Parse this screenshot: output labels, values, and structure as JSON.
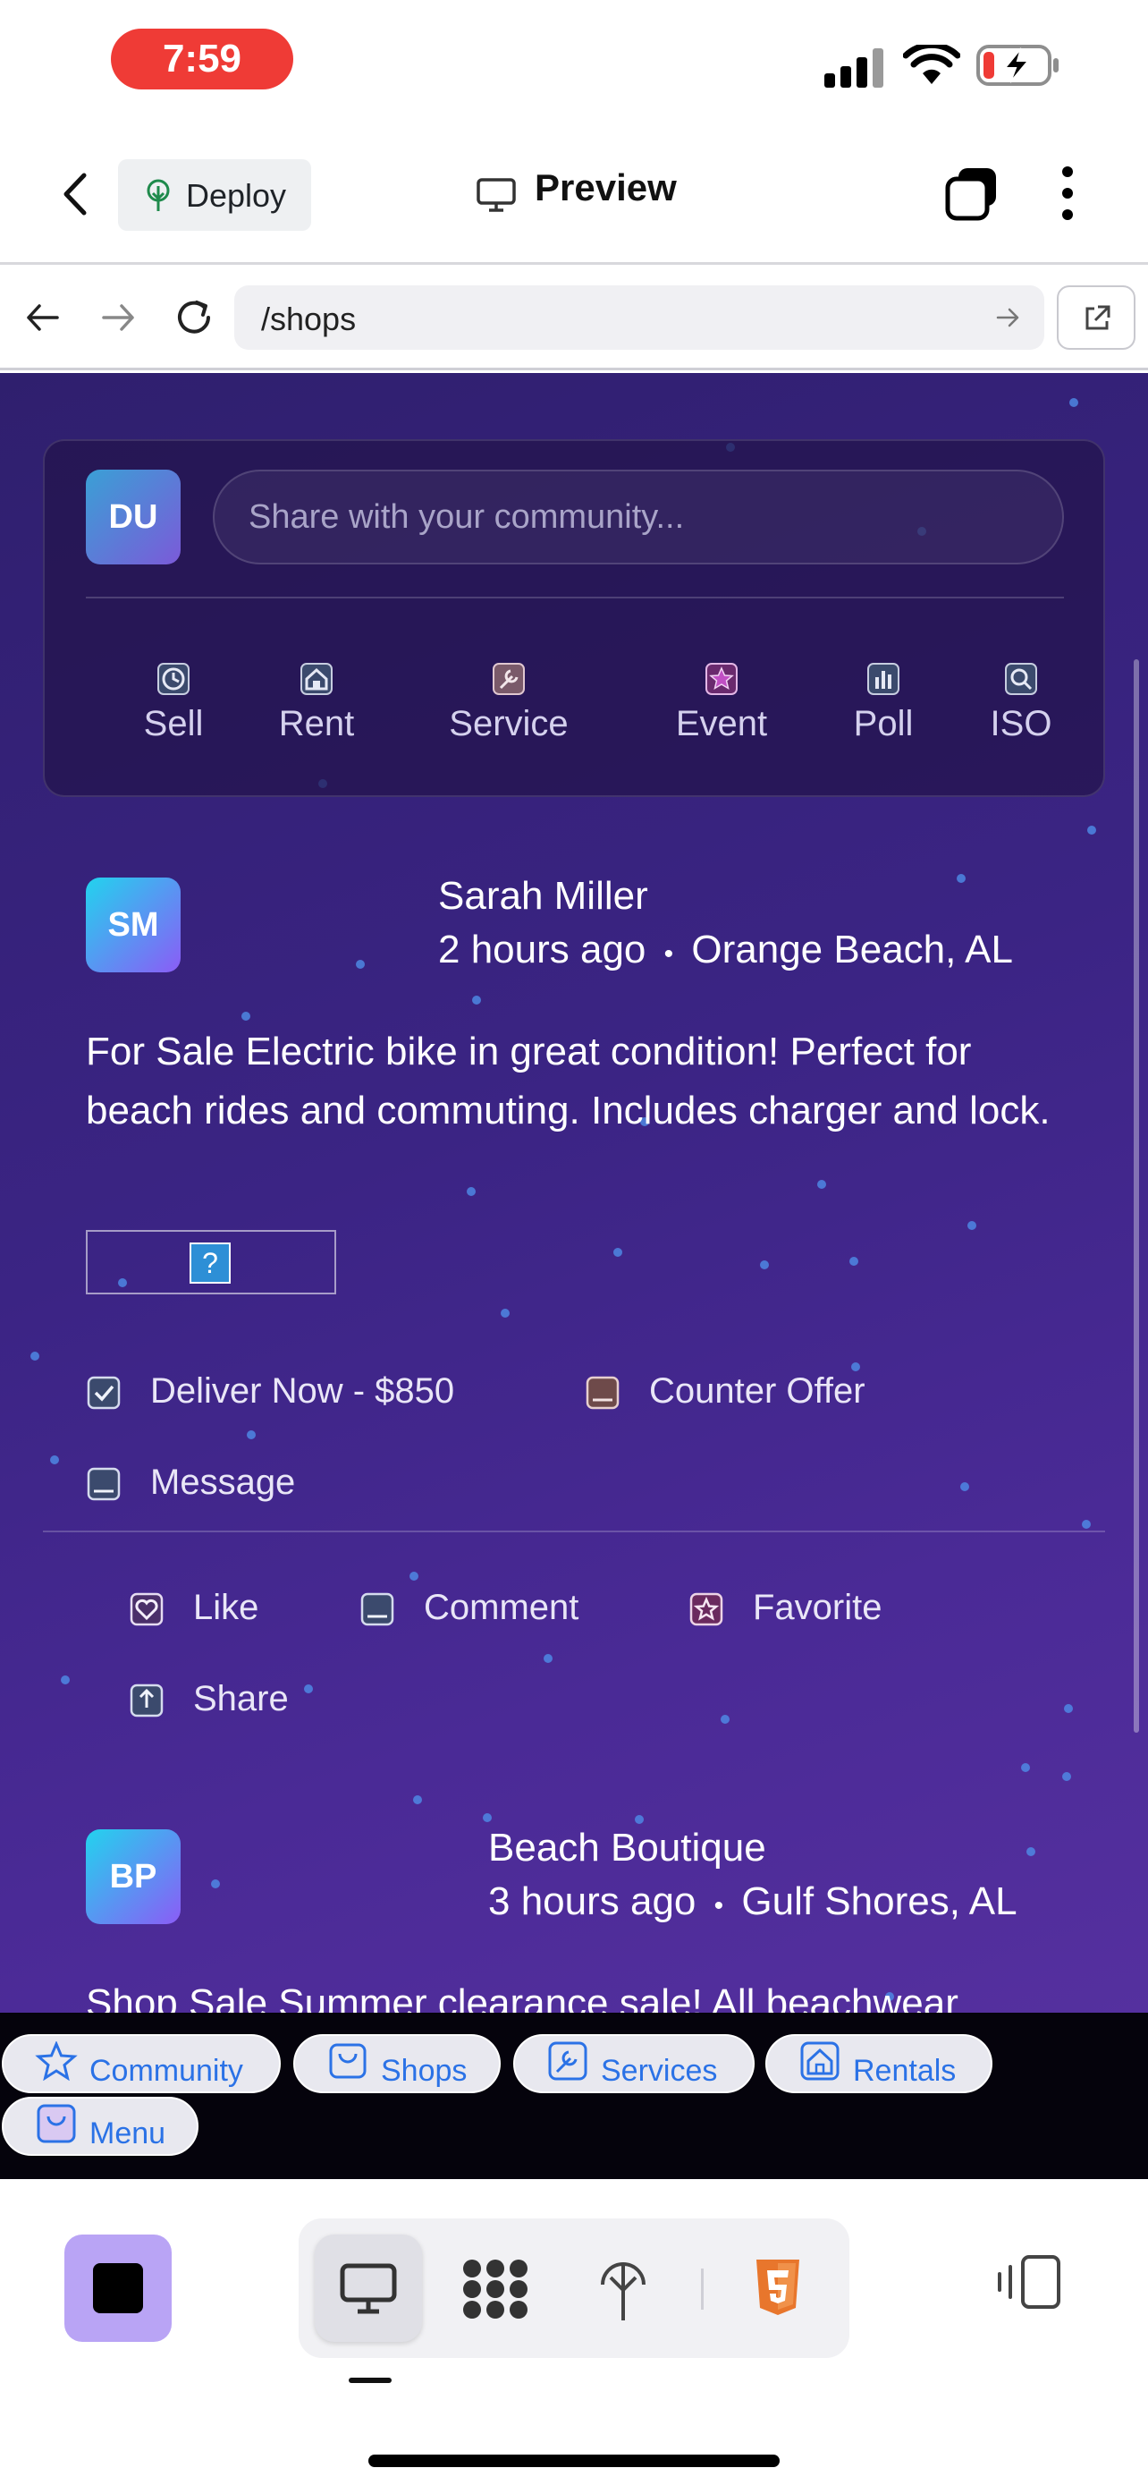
{
  "status_bar": {
    "time": "7:59"
  },
  "top_nav": {
    "deploy_label": "Deploy",
    "title": "Preview"
  },
  "url_bar": {
    "path": "/shops"
  },
  "composer": {
    "avatar_initials": "DU",
    "placeholder": "Share with your community...",
    "types": [
      "Sell",
      "Rent",
      "Service",
      "Event",
      "Poll",
      "ISO"
    ]
  },
  "posts": [
    {
      "avatar_initials": "SM",
      "author": "Sarah Miller",
      "time": "2 hours ago",
      "location": "Orange Beach, AL",
      "body": "For Sale Electric bike in great condition! Perfect for beach rides and commuting. Includes charger and lock.",
      "image_placeholder": "?",
      "deal_actions": [
        "Deliver Now - $850",
        "Counter Offer",
        "Message"
      ],
      "social_actions": [
        "Like",
        "Comment",
        "Favorite",
        "Share"
      ]
    },
    {
      "avatar_initials": "BP",
      "author": "Beach Boutique",
      "time": "3 hours ago",
      "location": "Gulf Shores, AL",
      "body": "Shop Sale Summer clearance sale! All beachwear"
    }
  ],
  "tab_strip": [
    "Community",
    "Shops",
    "Services",
    "Rentals",
    "Menu"
  ],
  "meta_separator": "•"
}
